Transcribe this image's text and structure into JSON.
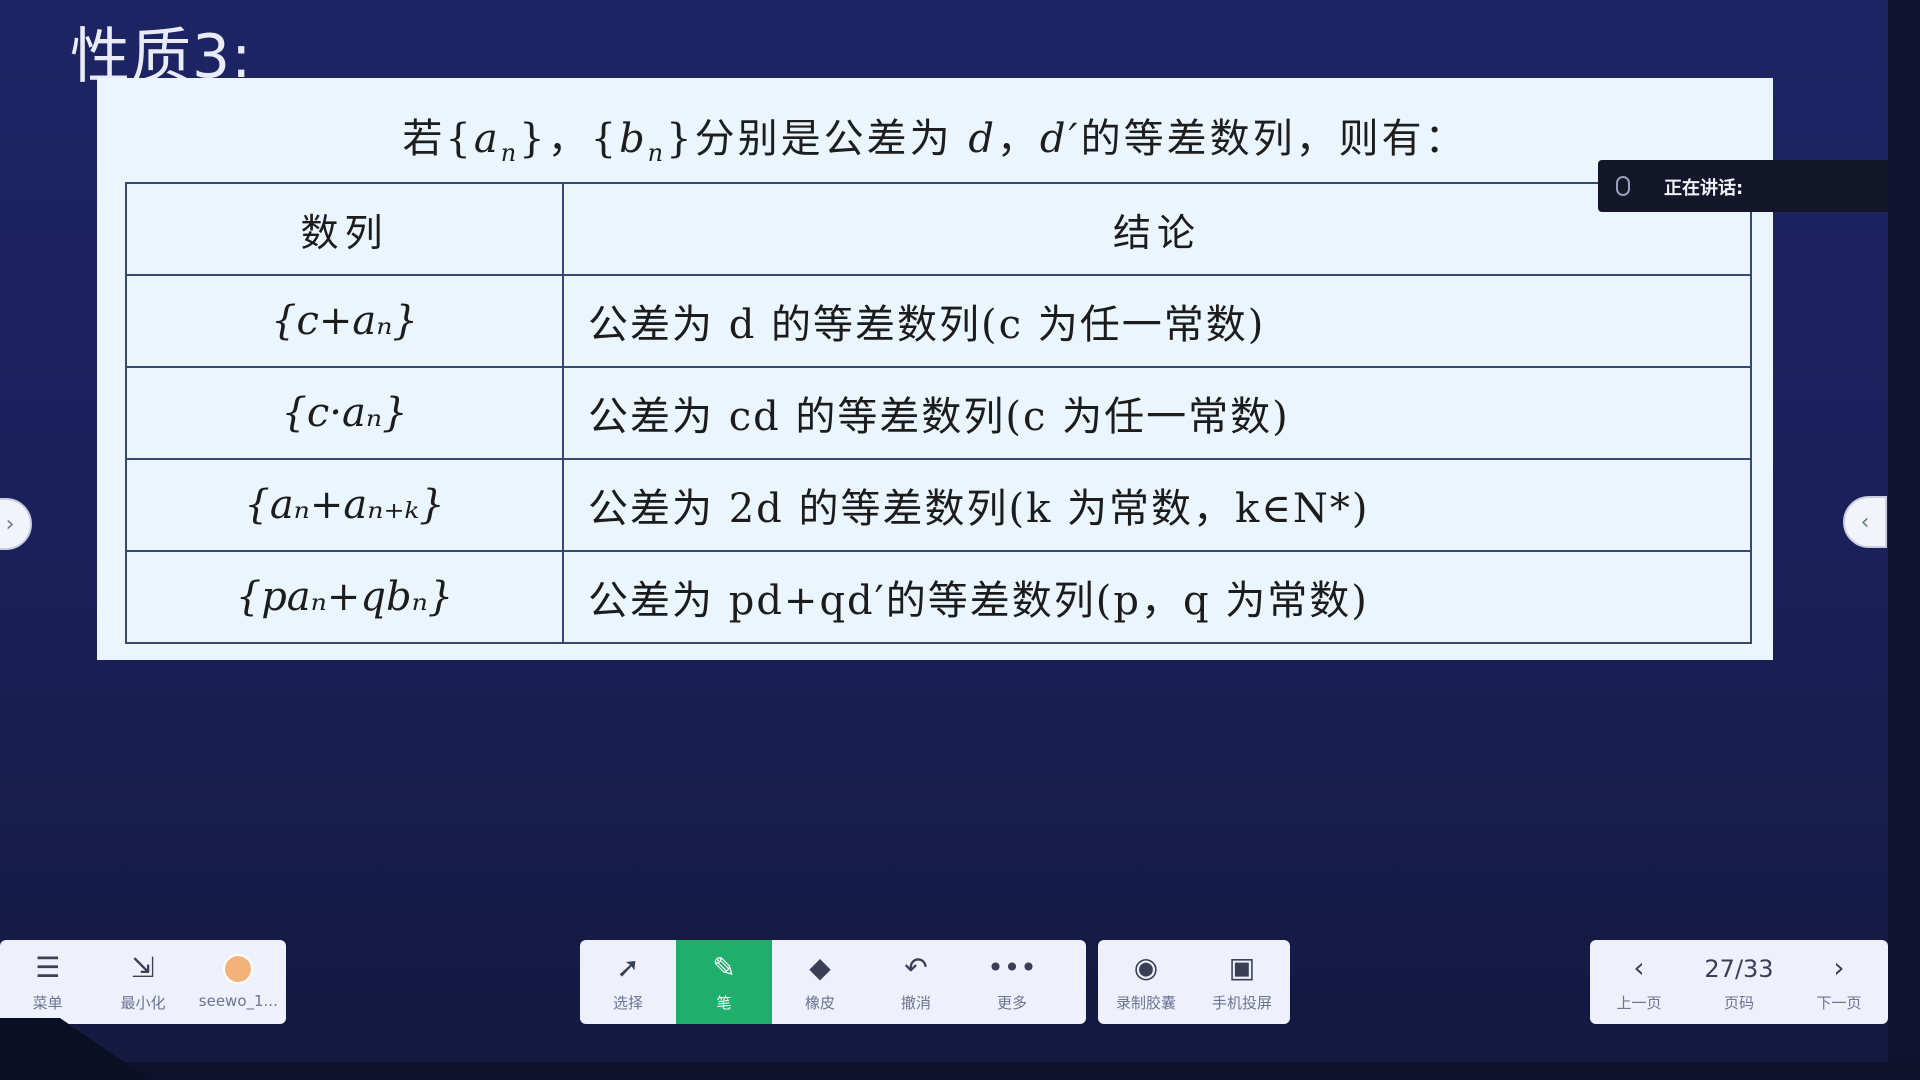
{
  "page_title": "性质3:",
  "slide": {
    "heading_pre": "若{",
    "heading_an": "a",
    "heading_an_sub": "n",
    "heading_mid1": "}，{",
    "heading_bn": "b",
    "heading_bn_sub": "n",
    "heading_mid2": "}分别是公差为 ",
    "heading_d": "d",
    "heading_comma": "，",
    "heading_d2": "d′",
    "heading_post": "的等差数列，则有：",
    "col_sequence": "数列",
    "col_conclusion": "结论",
    "rows": [
      {
        "sequence": "{c+aₙ}",
        "conclusion": "公差为 d 的等差数列(c 为任一常数)"
      },
      {
        "sequence": "{c·aₙ}",
        "conclusion": "公差为 cd 的等差数列(c 为任一常数)"
      },
      {
        "sequence": "{aₙ+aₙ₊ₖ}",
        "conclusion": "公差为 2d 的等差数列(k 为常数，k∈N*)"
      },
      {
        "sequence": "{paₙ+qbₙ}",
        "conclusion": "公差为 pd+qd′的等差数列(p，q 为常数)"
      }
    ]
  },
  "speaking_label": "正在讲话:",
  "left_toolbar": [
    {
      "icon": "menu-icon",
      "glyph": "☰",
      "label": "菜单"
    },
    {
      "icon": "minimize-icon",
      "glyph": "⇲",
      "label": "最小化"
    },
    {
      "icon": "user-avatar",
      "glyph": "",
      "label": "seewo_1..."
    }
  ],
  "center_toolbar": [
    {
      "icon": "cursor-icon",
      "glyph": "➚",
      "label": "选择"
    },
    {
      "icon": "pen-icon",
      "glyph": "✎",
      "label": "笔"
    },
    {
      "icon": "eraser-icon",
      "glyph": "◆",
      "label": "橡皮"
    },
    {
      "icon": "undo-icon",
      "glyph": "↶",
      "label": "撤消"
    },
    {
      "icon": "more-icon",
      "glyph": "•••",
      "label": "更多"
    }
  ],
  "record_toolbar": [
    {
      "icon": "eye-record-icon",
      "glyph": "◉",
      "label": "录制胶囊"
    },
    {
      "icon": "phone-cast-icon",
      "glyph": "▣",
      "label": "手机投屏"
    }
  ],
  "page_nav": {
    "prev_glyph": "‹",
    "prev_label": "上一页",
    "page": "27/33",
    "page_label": "页码",
    "next_glyph": "›",
    "next_label": "下一页"
  },
  "edge_left_glyph": "›",
  "edge_right_glyph": "‹",
  "colors": {
    "active_tool": "#1fae6c",
    "background": "#1c2464",
    "slide": "#eaf5fe"
  }
}
